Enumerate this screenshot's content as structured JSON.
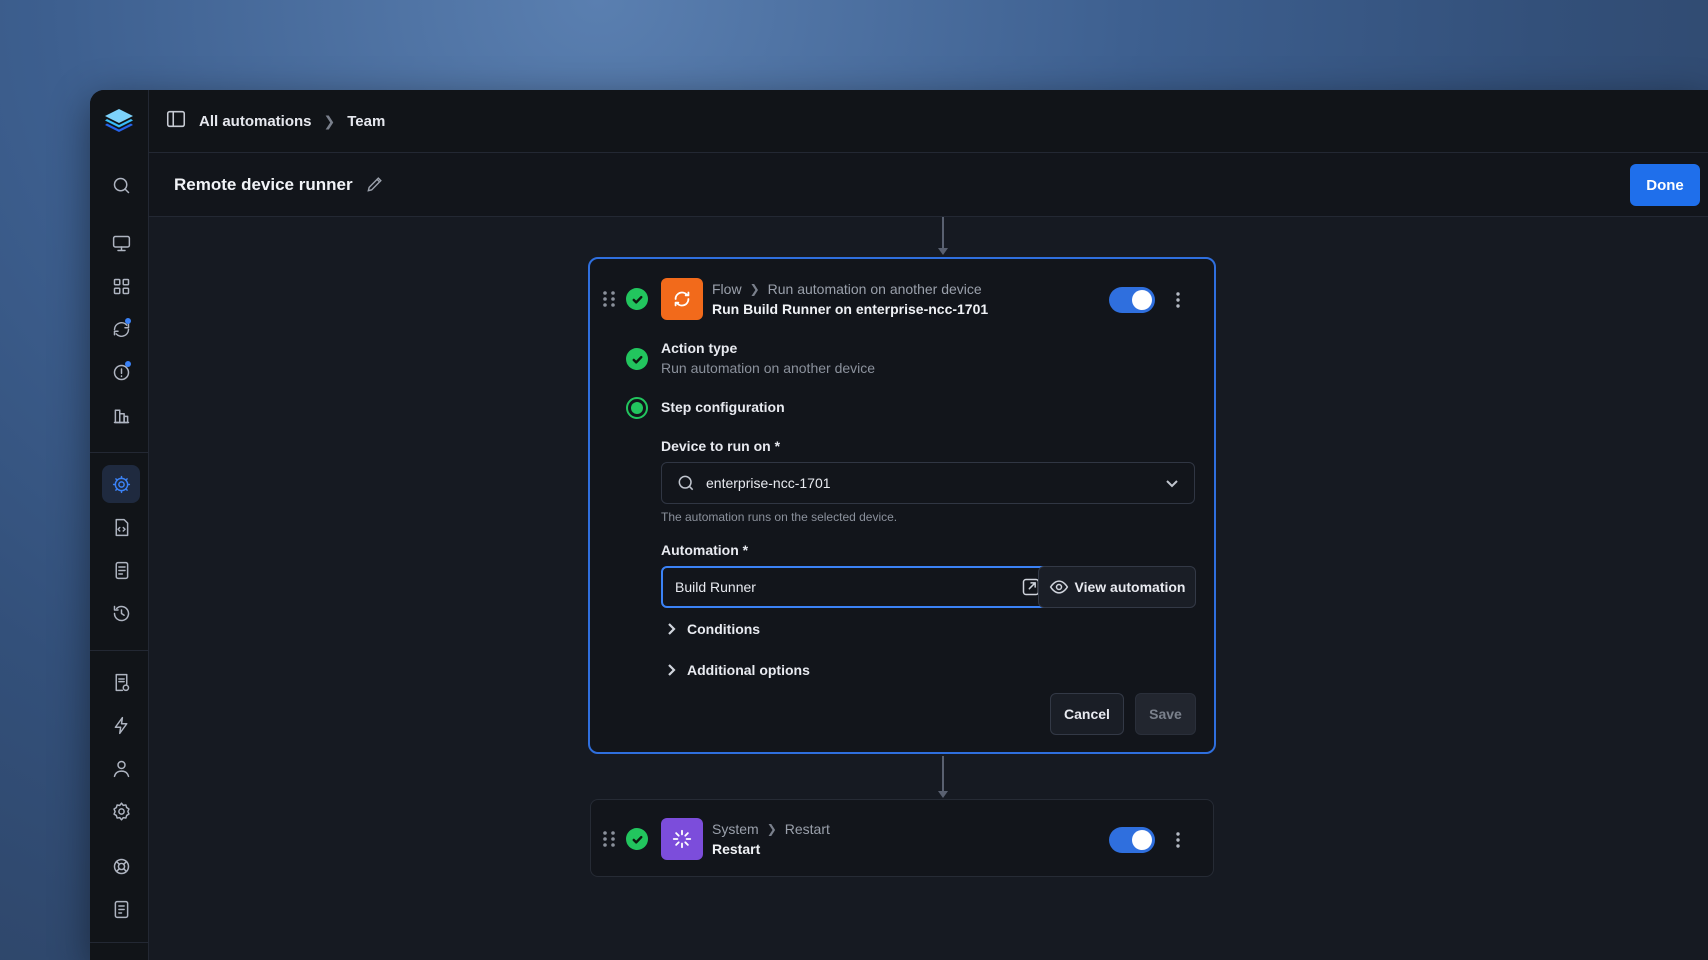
{
  "topbar": {
    "crumbs": [
      "All automations",
      "Team"
    ]
  },
  "header": {
    "title": "Remote device runner",
    "done_label": "Done"
  },
  "step1": {
    "breadcrumb": [
      "Flow",
      "Run automation on another device"
    ],
    "title": "Run Build Runner on enterprise-ncc-1701",
    "enabled": true,
    "icon": "flow-sync-icon",
    "icon_color": "#f26a1b",
    "action_type": {
      "label": "Action type",
      "value": "Run automation on another device"
    },
    "step_config": {
      "label": "Step configuration"
    },
    "device_field": {
      "label": "Device to run on",
      "required_mark": "*",
      "value": "enterprise-ncc-1701",
      "help": "The automation runs on the selected device."
    },
    "automation_field": {
      "label": "Automation",
      "required_mark": "*",
      "value": "Build Runner",
      "view_label": "View automation"
    },
    "conditions_label": "Conditions",
    "additional_label": "Additional options",
    "cancel_label": "Cancel",
    "save_label": "Save"
  },
  "step2": {
    "breadcrumb": [
      "System",
      "Restart"
    ],
    "title": "Restart",
    "enabled": true,
    "icon": "restart-spinner-icon",
    "icon_color": "#7c4ddb"
  },
  "colors": {
    "accent": "#1f6feb",
    "success": "#22c55e"
  }
}
